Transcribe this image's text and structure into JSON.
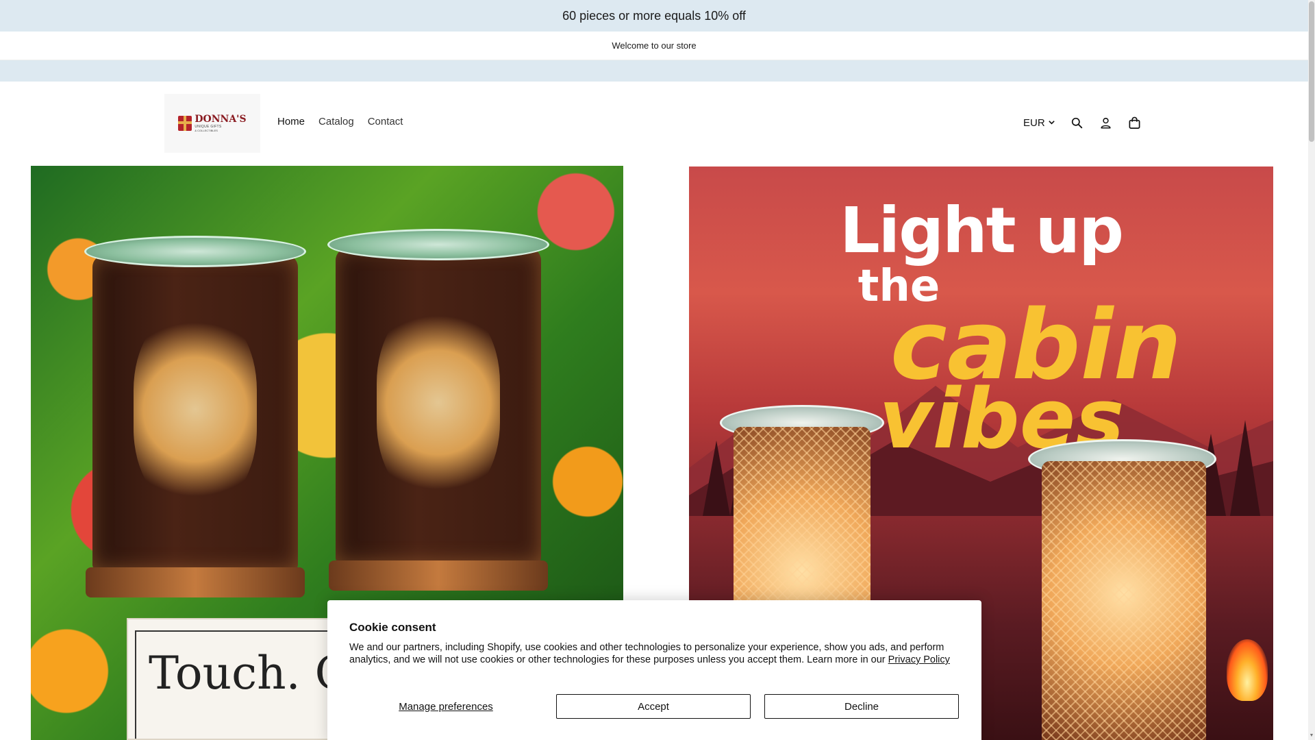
{
  "announcement": {
    "text": "60 pieces or more equals 10% off"
  },
  "welcome_bar": {
    "text": "Welcome to our store"
  },
  "header": {
    "logo": {
      "main": "DONNA'S",
      "sub": "UNIQUE GIFTS",
      "sub2": "& COLLECTIBLES"
    },
    "nav": [
      {
        "label": "Home"
      },
      {
        "label": "Catalog"
      },
      {
        "label": "Contact"
      }
    ],
    "currency": "EUR",
    "icons": [
      "search-icon",
      "account-icon",
      "cart-icon"
    ]
  },
  "hero": {
    "left_banner_text": "Touch. Glo",
    "right_heading": {
      "line1": "Light up",
      "line2": "the",
      "line3": "cabin",
      "line4": "vibes"
    }
  },
  "cookie": {
    "title": "Cookie consent",
    "body": "We and our partners, including Shopify, use cookies and other technologies to personalize your experience, show you ads, and perform analytics, and we will not use cookies or other technologies for these purposes unless you accept them. Learn more in our",
    "privacy_link": "Privacy Policy",
    "manage_label": "Manage preferences",
    "accept_label": "Accept",
    "decline_label": "Decline"
  },
  "colors": {
    "announcement_bg": "#dde9f1",
    "text": "#121212",
    "cabin_yellow": "#f8c232"
  }
}
